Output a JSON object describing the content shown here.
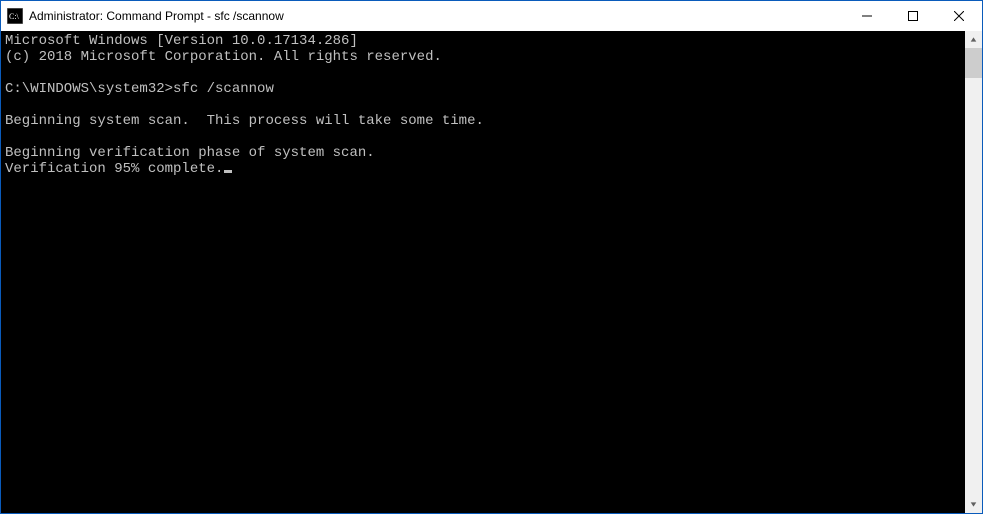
{
  "window": {
    "title": "Administrator: Command Prompt - sfc  /scannow"
  },
  "console": {
    "line1": "Microsoft Windows [Version 10.0.17134.286]",
    "line2": "(c) 2018 Microsoft Corporation. All rights reserved.",
    "blank1": "",
    "prompt_line": "C:\\WINDOWS\\system32>sfc /scannow",
    "blank2": "",
    "scan1": "Beginning system scan.  This process will take some time.",
    "blank3": "",
    "verify1": "Beginning verification phase of system scan.",
    "verify2": "Verification 95% complete."
  }
}
